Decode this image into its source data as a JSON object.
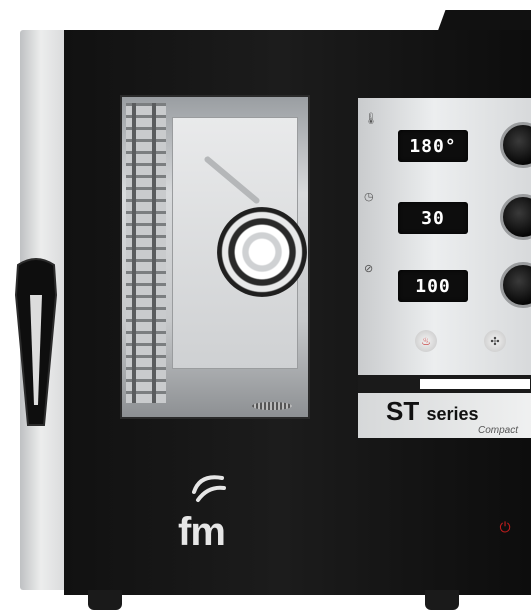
{
  "oven": {
    "displays": {
      "temperature": "180°",
      "time": "30",
      "humidity": "100"
    },
    "panel_icons": {
      "temperature": "thermometer-icon",
      "time": "clock-icon",
      "humidity": "humidity-icon",
      "heating": "heat-button-icon",
      "fan": "fan-button-icon"
    },
    "brand": {
      "series_title": "ST",
      "series_suffix": "series",
      "series_sub": "Compact",
      "logo_text": "fm"
    },
    "colors": {
      "body": "#111111",
      "panel": "#e3e5e6",
      "display_text": "#ffffff",
      "power": "#c21d1d"
    }
  }
}
